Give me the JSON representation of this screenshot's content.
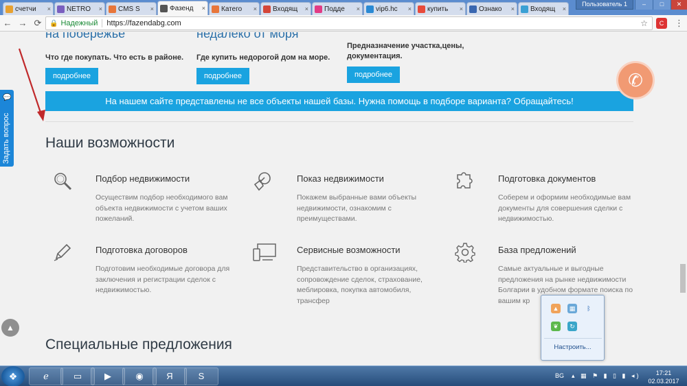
{
  "browser": {
    "tabs": [
      {
        "label": "счетчи",
        "icon": "bar-chart-icon",
        "color": "#e8a130",
        "active": false
      },
      {
        "label": "NETRO",
        "icon": "netro-icon",
        "color": "#7a5fbf",
        "active": false
      },
      {
        "label": "CMS S",
        "icon": "s-icon",
        "color": "#e8763a",
        "active": false
      },
      {
        "label": "Фазенд",
        "icon": "house-icon",
        "color": "#555555",
        "active": true
      },
      {
        "label": "Катего",
        "icon": "s-icon",
        "color": "#e8763a",
        "active": false
      },
      {
        "label": "Входящ",
        "icon": "gmail-icon",
        "color": "#d44638",
        "active": false
      },
      {
        "label": "Подде",
        "icon": "support-icon",
        "color": "#e23b85",
        "active": false
      },
      {
        "label": "vip6.hc",
        "icon": "check-icon",
        "color": "#2a8ad4",
        "active": false
      },
      {
        "label": "купить",
        "icon": "yandex-icon",
        "color": "#e84a3a",
        "active": false
      },
      {
        "label": "Ознако",
        "icon": "doc-icon",
        "color": "#3a67b0",
        "active": false
      },
      {
        "label": "Входящ",
        "icon": "mail-icon",
        "color": "#3aa0d4",
        "active": false
      }
    ],
    "user_label": "Пользователь 1",
    "window_controls": {
      "minimize": "–",
      "maximize": "□",
      "close": "✕"
    },
    "secure_label": "Надежный",
    "url": "https://fazendabg.com"
  },
  "top_section": {
    "columns": [
      {
        "heading_tail": "на побережье",
        "blurb": "Что где покупать. Что есть в районе.",
        "button": "подробнее"
      },
      {
        "heading_tail": "недалеко от моря",
        "blurb": "Где купить недорогой дом на море.",
        "button": "подробнее"
      },
      {
        "heading_tail": "",
        "blurb": "Предназначение участка,цены, документация.",
        "button": "подробнее"
      }
    ],
    "banner": "На нашем сайте представлены не все объекты нашей базы. Нужна помощь в подборе варианта? Обращайтесь!"
  },
  "features": {
    "title": "Наши возможности",
    "items": [
      {
        "icon": "magnifier-icon",
        "title": "Подбор недвижимости",
        "desc": "Осуществим подбор необходимого вам объекта недвижимости с учетом ваших пожеланий."
      },
      {
        "icon": "cursor-tap-icon",
        "title": "Показ недвижимости",
        "desc": "Покажем выбранные вами объекты недвижимости, ознакомим с преимуществами."
      },
      {
        "icon": "puzzle-icon",
        "title": "Подготовка документов",
        "desc": "Соберем и оформим необходимые вам документы для совершения сделки с недвижимостью."
      },
      {
        "icon": "pencil-icon",
        "title": "Подготовка договоров",
        "desc": "Подготовим необходимые договора для заключения и регистрации сделок с недвижимостью."
      },
      {
        "icon": "devices-icon",
        "title": "Сервисные возможности",
        "desc": "Представительство в организациях, сопровождение сделок, страхование, меблировка, покупка автомобиля, трансфер"
      },
      {
        "icon": "gear-icon",
        "title": "База предложений",
        "desc": "Самые актуальные и выгодные предложения на рынке недвижимости Болгарии в удобном формате поиска по вашим кр"
      }
    ]
  },
  "special": {
    "title": "Специальные предложения"
  },
  "side_tab": {
    "label": "Задать вопрос"
  },
  "tray_popup": {
    "configure": "Настроить..."
  },
  "taskbar": {
    "lang": "BG",
    "time": "17:21",
    "date": "02.03.2017"
  },
  "colors": {
    "accent": "#1aa3e0",
    "phone": "#f19a73",
    "side_tab": "#1c86d8"
  }
}
